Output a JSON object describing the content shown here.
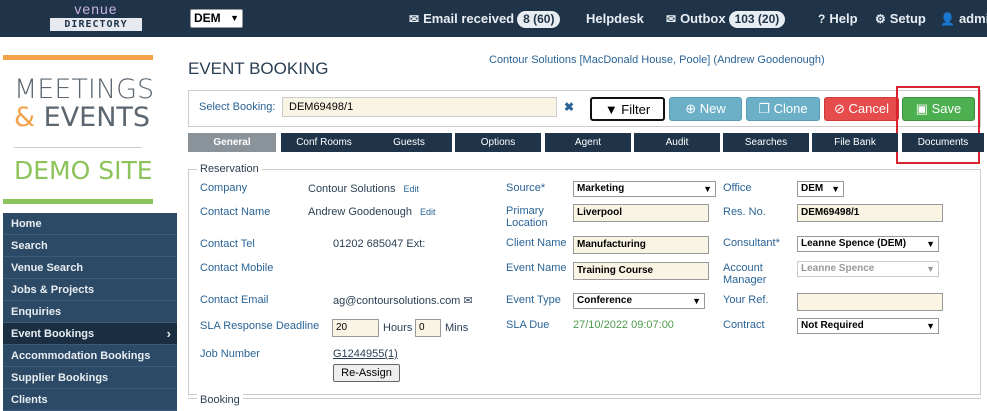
{
  "topbar": {
    "logo_line1": "venue",
    "logo_line2": "DIRECTORY",
    "region": "DEM",
    "email_received_label": "Email received",
    "email_received_count": "8 (60)",
    "helpdesk_label": "Helpdesk",
    "outbox_label": "Outbox",
    "outbox_count": "103 (20)",
    "help_label": "Help",
    "setup_label": "Setup",
    "admin_label": "admin"
  },
  "brand": {
    "line1": "MEETINGS",
    "amp": "&",
    "line2_rest": " EVENTS",
    "line3": "DEMO SITE"
  },
  "sidebar": {
    "items": [
      {
        "label": "Home"
      },
      {
        "label": "Search"
      },
      {
        "label": "Venue Search"
      },
      {
        "label": "Jobs & Projects"
      },
      {
        "label": "Enquiries"
      },
      {
        "label": "Event Bookings"
      },
      {
        "label": "Accommodation Bookings"
      },
      {
        "label": "Supplier Bookings"
      },
      {
        "label": "Clients"
      }
    ],
    "active_arrow": "›"
  },
  "page": {
    "title": "EVENT BOOKING",
    "context": "Contour Solutions [MacDonald House, Poole] (Andrew Goodenough)"
  },
  "bookbar": {
    "label": "Select Booking:",
    "value": "DEM69498/1",
    "clear": "✖",
    "filter": "Filter",
    "new": "New",
    "clone": "Clone",
    "cancel": "Cancel",
    "save": "Save"
  },
  "tabs": [
    "General",
    "Conf Rooms",
    "Guests",
    "Options",
    "Agent",
    "Audit",
    "Searches",
    "File Bank",
    "Documents"
  ],
  "reservation": {
    "legend": "Reservation",
    "company_label": "Company",
    "company_value": "Contour Solutions",
    "edit": "Edit",
    "contact_name_label": "Contact Name",
    "contact_name_value": "Andrew Goodenough",
    "contact_tel_label": "Contact Tel",
    "contact_tel_value": "01202 685047 Ext:",
    "contact_mobile_label": "Contact Mobile",
    "contact_email_label": "Contact Email",
    "contact_email_value": "ag@contoursolutions.com",
    "sla_label": "SLA Response Deadline",
    "sla_hours": "20",
    "hours_label": "Hours",
    "sla_mins": "0",
    "mins_label": "Mins",
    "job_number_label": "Job Number",
    "job_number_value": "G1244955(1)",
    "reassign": "Re-Assign",
    "source_label": "Source*",
    "source_value": "Marketing",
    "primary_location_label_1": "Primary",
    "primary_location_label_2": "Location",
    "primary_location_value": "Liverpool",
    "client_name_label": "Client Name",
    "client_name_value": "Manufacturing",
    "event_name_label": "Event Name",
    "event_name_value": "Training Course",
    "event_type_label": "Event Type",
    "event_type_value": "Conference",
    "sla_due_label": "SLA Due",
    "sla_due_value": "27/10/2022 09:07:00",
    "office_label": "Office",
    "office_value": "DEM",
    "res_no_label": "Res. No.",
    "res_no_value": "DEM69498/1",
    "consultant_label": "Consultant*",
    "consultant_value": "Leanne Spence (DEM)",
    "account_manager_label_1": "Account",
    "account_manager_label_2": "Manager",
    "account_manager_value": "Leanne Spence",
    "your_ref_label": "Your Ref.",
    "your_ref_value": "",
    "contract_label": "Contract",
    "contract_value": "Not Required"
  },
  "booking_section": {
    "legend": "Booking"
  }
}
